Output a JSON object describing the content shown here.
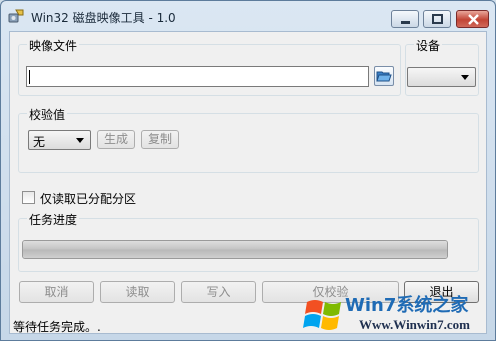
{
  "window": {
    "title": "Win32 磁盘映像工具 - 1.0",
    "controls": [
      "minimize-icon",
      "maximize-icon",
      "close-icon"
    ]
  },
  "image_file": {
    "group_label": "映像文件",
    "path_value": "",
    "browse_icon": "folder-open-icon"
  },
  "device": {
    "group_label": "设备",
    "selected": ""
  },
  "hash": {
    "group_label": "校验值",
    "algorithm_selected": "无",
    "generate_label": "生成",
    "copy_label": "复制"
  },
  "options": {
    "read_only_allocated_label": "仅读取已分配分区",
    "read_only_allocated_checked": false
  },
  "progress": {
    "group_label": "任务进度",
    "percent": 100
  },
  "actions": {
    "cancel_label": "取消",
    "read_label": "读取",
    "write_label": "写入",
    "verify_only_label": "仅校验",
    "exit_label": "退出"
  },
  "status_text": "等待任务完成。.",
  "watermark": {
    "brand": "Win7系统之家",
    "url": "Www.Winwin7.com"
  },
  "colors": {
    "title_bar": "#c6d7e8",
    "close_button": "#c24435",
    "watermark_blue": "#1f6bb5"
  }
}
